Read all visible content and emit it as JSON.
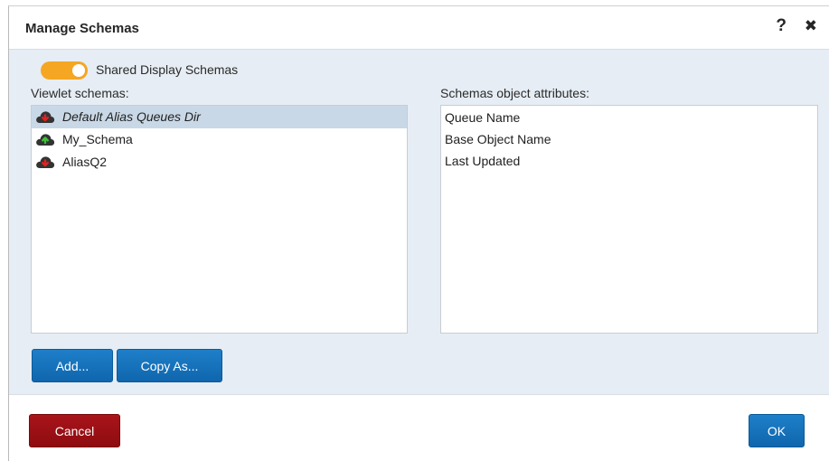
{
  "dialog": {
    "title": "Manage Schemas",
    "help_symbol": "?",
    "close_symbol": "✖"
  },
  "toggle": {
    "label": "Shared Display Schemas",
    "on": true,
    "color": "#f5a623"
  },
  "viewlet_schemas": {
    "label": "Viewlet schemas:",
    "items": [
      {
        "name": "Default Alias Queues Dir",
        "icon": "cloud-download-red-icon",
        "selected": true
      },
      {
        "name": "My_Schema",
        "icon": "cloud-upload-green-icon",
        "selected": false
      },
      {
        "name": "AliasQ2",
        "icon": "cloud-download-red-icon",
        "selected": false
      }
    ]
  },
  "attributes": {
    "label": "Schemas object attributes:",
    "items": [
      "Queue Name",
      "Base Object Name",
      "Last Updated"
    ]
  },
  "buttons": {
    "add": "Add...",
    "copy_as": "Copy As...",
    "cancel": "Cancel",
    "ok": "OK"
  },
  "colors": {
    "accent_blue": "#1173bd",
    "danger_red": "#9a1015",
    "body_bg": "#e6edf4",
    "selection": "#c9d8e6"
  }
}
